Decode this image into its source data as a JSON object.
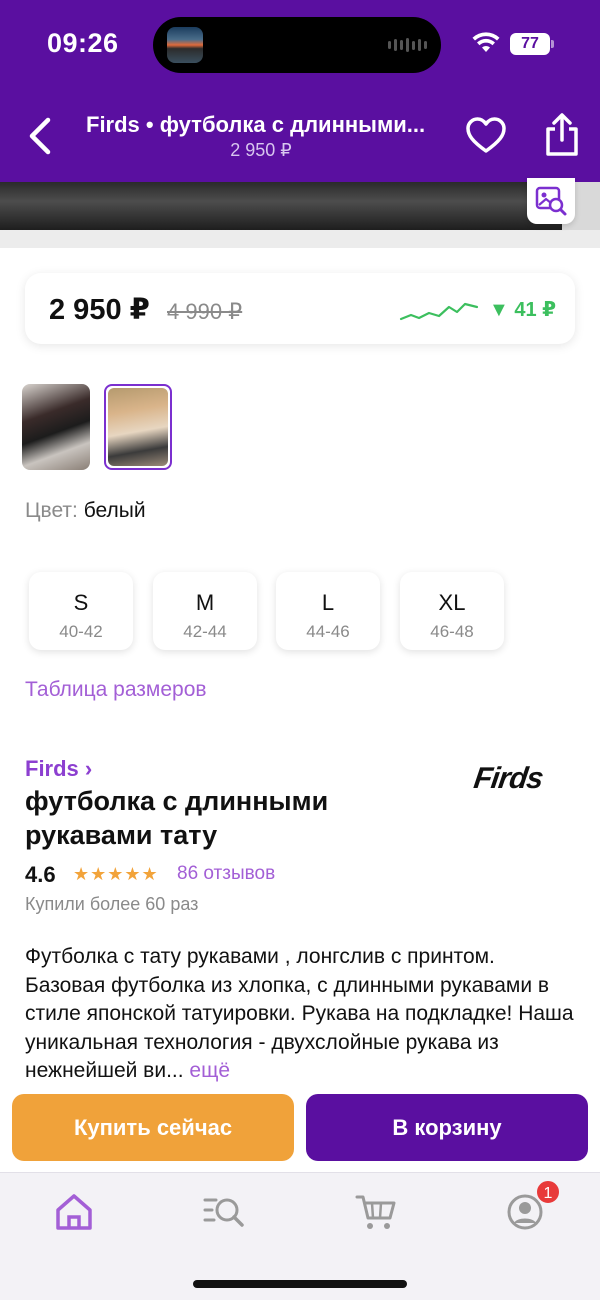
{
  "status_bar": {
    "time": "09:26",
    "battery": "77"
  },
  "header": {
    "title": "Firds • футболка с длинными...",
    "subtitle": "2 950 ₽"
  },
  "price_card": {
    "current": "2 950 ₽",
    "old": "4 990 ₽",
    "drop": "▼ 41 ₽",
    "colors": {
      "drop": "#3cbf5e",
      "graph": "#3cbf5e"
    }
  },
  "color": {
    "label": "Цвет:",
    "value": "белый"
  },
  "sizes": [
    {
      "size": "S",
      "range": "40-42"
    },
    {
      "size": "M",
      "range": "42-44"
    },
    {
      "size": "L",
      "range": "44-46"
    },
    {
      "size": "XL",
      "range": "46-48"
    }
  ],
  "size_table_link": "Таблица размеров",
  "product": {
    "brand": "Firds ›",
    "brand_logo": "Firds",
    "title": "футболка с длинными рукавами тату",
    "rating": "4.6",
    "stars": "★★★★★",
    "reviews": "86 отзывов",
    "bought": "Купили более 60 раз",
    "description": "Футболка с тату рукавами , лонгслив с принтом. Базовая футболка из хлопка, с длинными рукавами в стиле японской татуировки. Рукава на подкладке! Наша уникальная технология - двухслойные рукава из нежнейшей ви...",
    "more": "ещё"
  },
  "actions": {
    "buy_now": "Купить сейчас",
    "add_to_cart": "В корзину"
  },
  "tabbar": {
    "items": [
      "home-icon",
      "catalog-search-icon",
      "cart-icon",
      "profile-icon"
    ],
    "profile_badge": "1"
  },
  "theme": {
    "primary": "#5a0fa0",
    "accent": "#a35fd6",
    "orange": "#f0a23a"
  }
}
